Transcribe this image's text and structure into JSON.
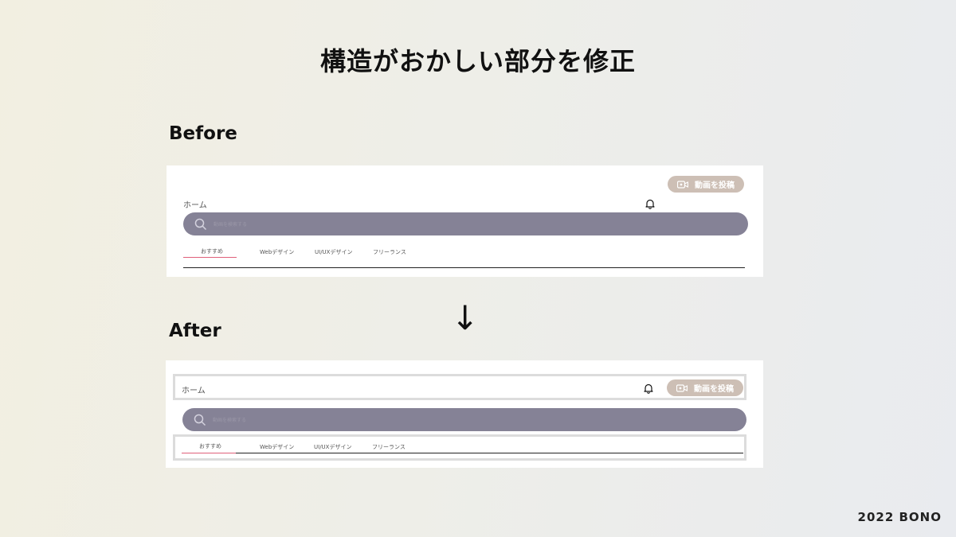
{
  "slide": {
    "title": "構造がおかしい部分を修正",
    "before_label": "Before",
    "after_label": "After",
    "arrow": "↓",
    "footer": "2022 BONO"
  },
  "mockup": {
    "home_label": "ホーム",
    "post_button_label": "動画を投稿",
    "search_placeholder": "動画を検索する",
    "tabs": [
      "おすすめ",
      "Webデザイン",
      "UI/UXデザイン",
      "フリーランス"
    ],
    "active_tab": "おすすめ"
  },
  "colors": {
    "search_bar": "#858296",
    "post_button": "#cdbfb5",
    "active_tab_underline": "#e0607a",
    "highlight_frame": "#dcdcdc"
  },
  "icons": [
    "bell-icon",
    "video-camera-icon",
    "search-icon",
    "arrow-down-icon"
  ]
}
